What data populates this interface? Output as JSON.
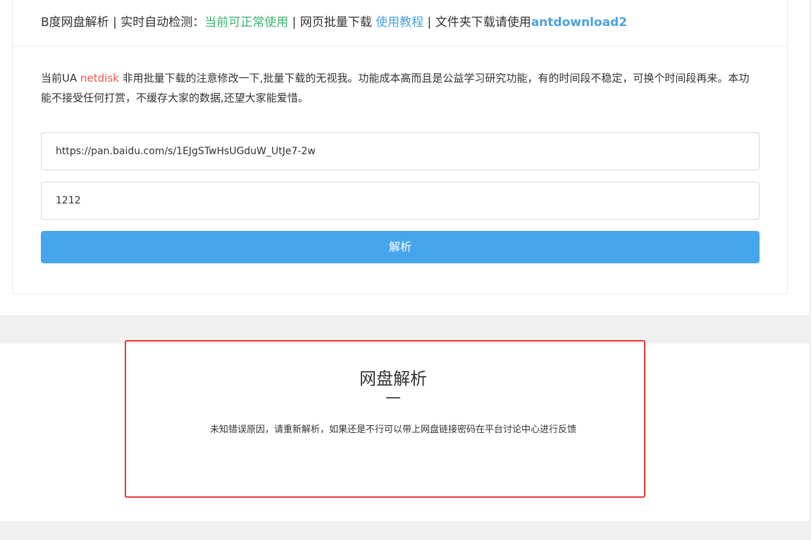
{
  "header": {
    "brand": "B度网盘解析 | 实时自动检测：",
    "status": "当前可正常使用",
    "sep1": " | 网页批量下载 ",
    "tutorial_link": "使用教程",
    "sep2": " | 文件夹下载请使用",
    "tool_link": "antdownload2"
  },
  "notice": {
    "prefix": "当前UA ",
    "ua": "netdisk",
    "text": " 非用批量下载的注意修改一下,批量下载的无视我。功能成本高而且是公益学习研究功能，有的时间段不稳定，可换个时间段再来。本功能不接受任何打赏，不缓存大家的数据,还望大家能爱惜。"
  },
  "form": {
    "url_value": "https://pan.baidu.com/s/1EJgSTwHsUGduW_UtJe7-2w",
    "password_value": "1212",
    "submit_label": "解析"
  },
  "result": {
    "title": "网盘解析",
    "message": "未知错误原因，请重新解析，如果还是不行可以带上网盘链接密码在平台讨论中心进行反馈"
  },
  "colors": {
    "status_green": "#3cb371",
    "link_blue": "#4aa3df",
    "ua_red": "#e9544e",
    "button_blue": "#46a6ed",
    "highlight_red": "#e53935"
  }
}
